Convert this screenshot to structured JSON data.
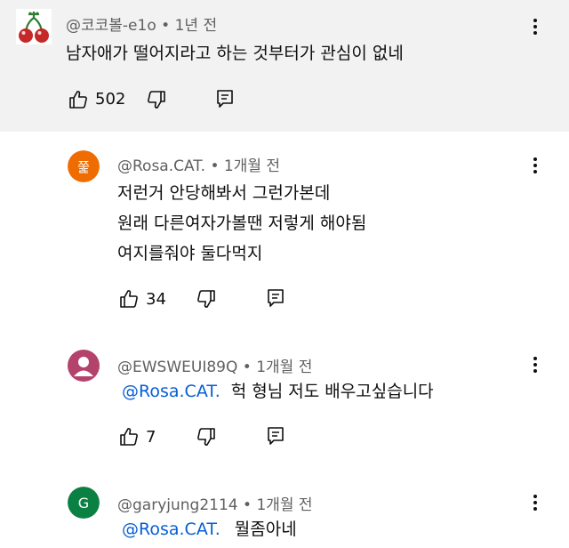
{
  "comments": [
    {
      "author": "@코코볼-e1o",
      "time": "1년 전",
      "lines": [
        "남자애가 떨어지라고 하는 것부터가 관심이 없네"
      ],
      "likes": "502",
      "avatar": {
        "type": "cherry-icon"
      }
    },
    {
      "author": "@Rosa.CAT.",
      "time": "1개월 전",
      "lines": [
        "저런거 안당해봐서 그런가본데",
        "원래 다른여자가볼땐 저렇게 해야됨",
        "여지를줘야 둘다먹지"
      ],
      "likes": "34",
      "avatar": {
        "type": "letter",
        "letter": "쭕",
        "color": "#ef6c00"
      }
    },
    {
      "author": "@EWSWEUI89Q",
      "time": "1개월 전",
      "mention": "@Rosa.CAT.",
      "text": "헉 형님 저도 배우고싶습니다",
      "likes": "7",
      "avatar": {
        "type": "person-icon",
        "color": "#b3436b"
      }
    },
    {
      "author": "@garyjung2114",
      "time": "1개월 전",
      "mention": "@Rosa.CAT.",
      "text": "뭘좀아네",
      "avatar": {
        "type": "letter",
        "letter": "G",
        "color": "#0b8043"
      }
    }
  ],
  "colors": {
    "mention": "#065fd4",
    "highlight_bg": "#f2f2f2",
    "meta": "#606060"
  }
}
